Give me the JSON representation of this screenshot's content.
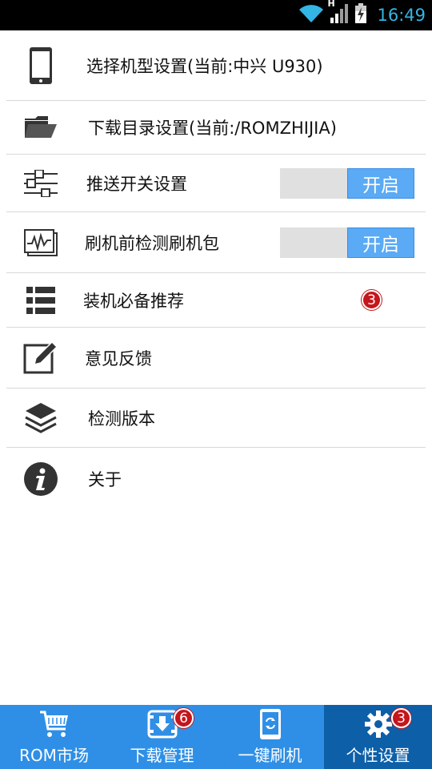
{
  "status_bar": {
    "time": "16:49",
    "network_type": "H",
    "icons": [
      "wifi-icon",
      "signal-icon",
      "battery-charging-icon"
    ]
  },
  "settings": {
    "items": [
      {
        "label": "选择机型设置(当前:中兴 U930)",
        "icon": "phone-icon"
      },
      {
        "label": "下载目录设置(当前:/ROMZHIJIA)",
        "icon": "folder-icon"
      },
      {
        "label": "推送开关设置",
        "icon": "sliders-icon",
        "toggle": "开启"
      },
      {
        "label": "刷机前检测刷机包",
        "icon": "monitor-chart-icon",
        "toggle": "开启"
      },
      {
        "label": "装机必备推荐",
        "icon": "list-icon",
        "badge": "3"
      },
      {
        "label": "意见反馈",
        "icon": "edit-icon"
      },
      {
        "label": "检测版本",
        "icon": "layers-icon"
      },
      {
        "label": "关于",
        "icon": "info-icon"
      }
    ]
  },
  "bottom_nav": {
    "tabs": [
      {
        "label": "ROM市场",
        "icon": "cart-icon"
      },
      {
        "label": "下载管理",
        "icon": "download-icon",
        "badge": "6"
      },
      {
        "label": "一键刷机",
        "icon": "phone-refresh-icon"
      },
      {
        "label": "个性设置",
        "icon": "gear-icon",
        "badge": "3",
        "active": true
      }
    ]
  },
  "colors": {
    "status_text": "#33b5e5",
    "toggle_on": "#5aaaf5",
    "badge": "#c4161c",
    "nav_bg": "#2f8fe6",
    "nav_active": "#0d5fa8"
  }
}
